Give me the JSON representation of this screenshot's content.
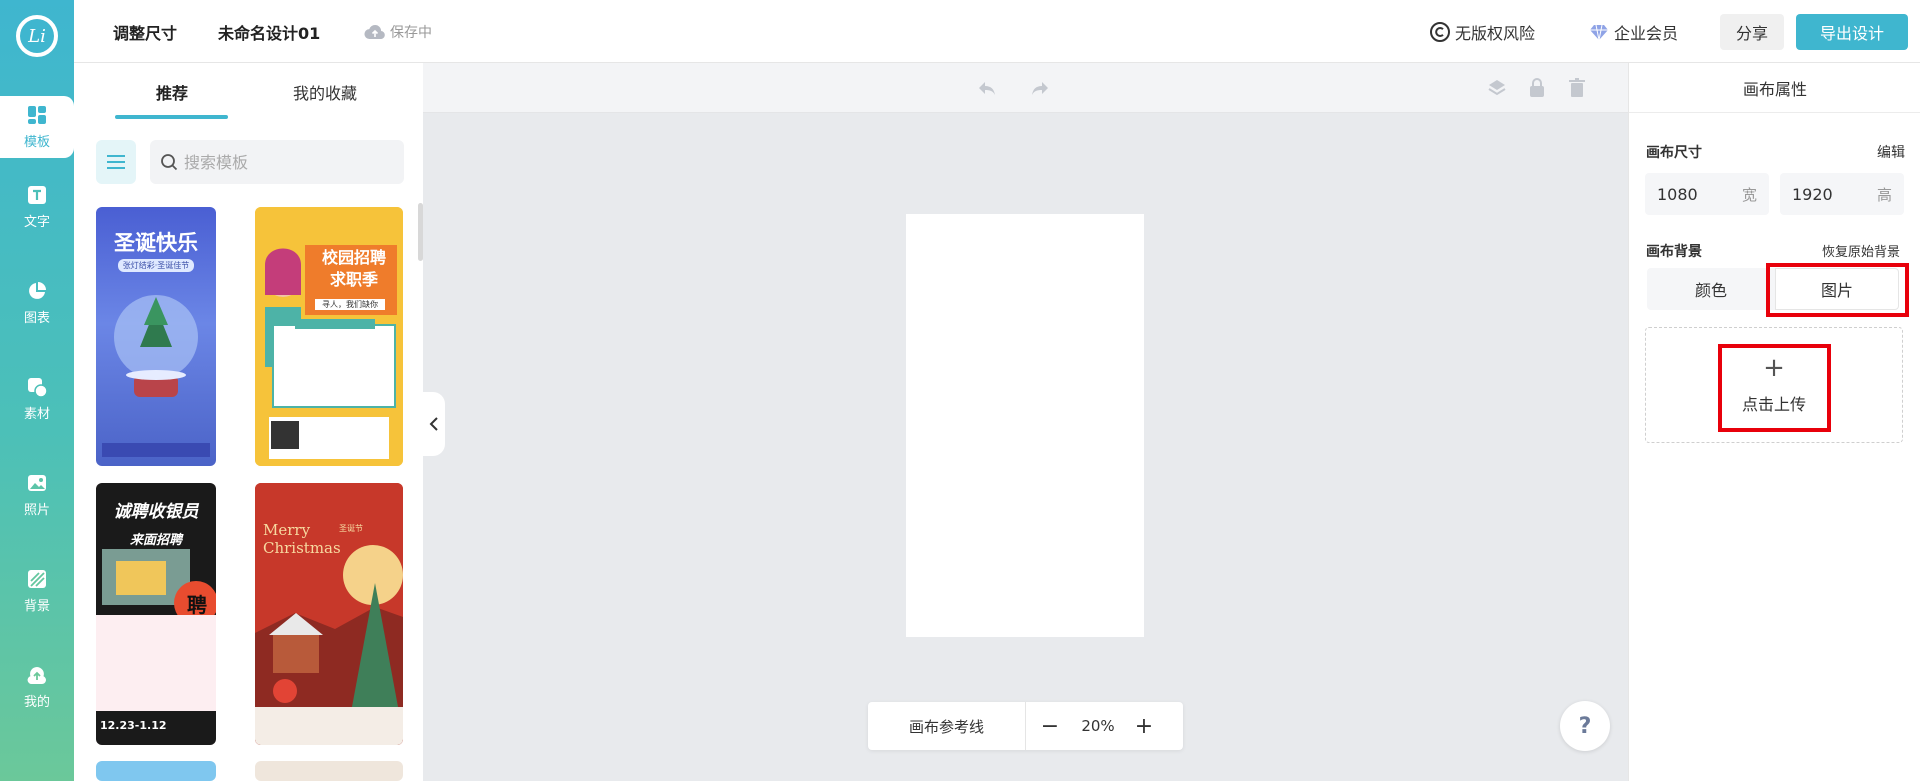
{
  "header": {
    "resize": "调整尺寸",
    "design_name": "未命名设计01",
    "save_status": "保存中",
    "copyright": "无版权风险",
    "vip": "企业会员",
    "share": "分享",
    "export": "导出设计"
  },
  "rail": {
    "logo": "Li",
    "items": [
      {
        "label": "模板",
        "icon": "template-icon"
      },
      {
        "label": "文字",
        "icon": "text-icon"
      },
      {
        "label": "图表",
        "icon": "chart-icon"
      },
      {
        "label": "素材",
        "icon": "material-icon"
      },
      {
        "label": "照片",
        "icon": "photo-icon"
      },
      {
        "label": "背景",
        "icon": "background-icon"
      },
      {
        "label": "我的",
        "icon": "upload-icon"
      }
    ]
  },
  "templates": {
    "tabs": [
      "推荐",
      "我的收藏"
    ],
    "search_placeholder": "搜索模板",
    "cards": [
      {
        "title": "圣诞快乐",
        "subtitle": "张灯结彩·圣诞佳节"
      },
      {
        "title": "校园招聘 求职季",
        "subtitle": "寻人，我们缺你"
      },
      {
        "title": "诚聘收银员",
        "subtitle": "来面招聘",
        "badge": "聘",
        "date": "12.23-1.12"
      },
      {
        "title": "Merry Christmas",
        "subtitle": "圣诞节"
      }
    ]
  },
  "canvas": {
    "guide_label": "画布参考线",
    "zoom": "20%",
    "help": "?"
  },
  "properties": {
    "title": "画布属性",
    "size_label": "画布尺寸",
    "edit": "编辑",
    "width": "1080",
    "width_unit": "宽",
    "height": "1920",
    "height_unit": "高",
    "bg_label": "画布背景",
    "restore": "恢复原始背景",
    "color_tab": "颜色",
    "image_tab": "图片",
    "upload_label": "点击上传",
    "upload_plus": "+"
  },
  "colors": {
    "accent": "#3fb6cf",
    "highlight": "#e8000b"
  }
}
